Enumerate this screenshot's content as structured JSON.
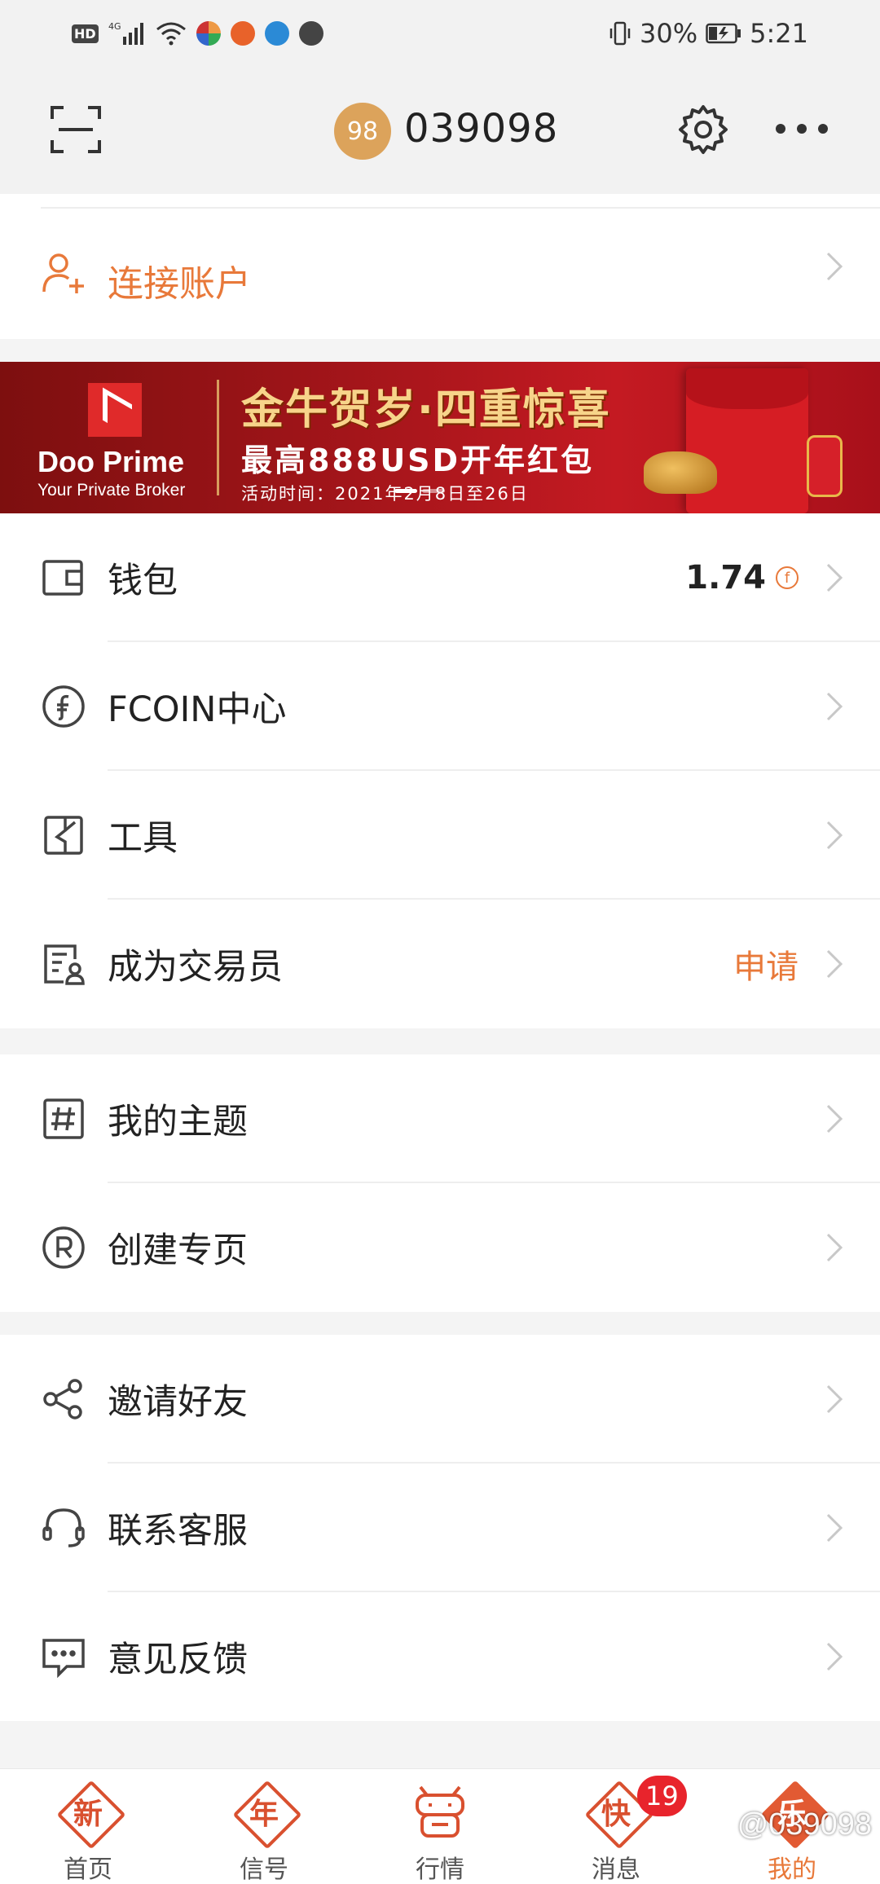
{
  "status_bar": {
    "hd": "HD",
    "signal": "4G",
    "battery": "30%",
    "time": "5:21"
  },
  "header": {
    "avatar_text": "98",
    "username": "039098",
    "icons": [
      "scan-icon",
      "gear-icon",
      "more-icon"
    ]
  },
  "connect": {
    "label": "连接账户",
    "icon": "add-user-icon"
  },
  "banner": {
    "brand": "Doo Prime",
    "brand_sub": "Your Private Broker",
    "headline": "金牛贺岁·四重惊喜",
    "sub": "最高888USD开年红包",
    "date": "活动时间：2021年2月8日至26日"
  },
  "menu_group_1": [
    {
      "label": "钱包",
      "value": "1.74",
      "icon": "wallet-icon",
      "coin": "f"
    },
    {
      "label": "FCOIN中心",
      "icon": "fcoin-icon"
    },
    {
      "label": "工具",
      "icon": "tools-icon"
    },
    {
      "label": "成为交易员",
      "accent": "申请",
      "icon": "trader-icon"
    }
  ],
  "menu_group_2": [
    {
      "label": "我的主题",
      "icon": "hashtag-icon"
    },
    {
      "label": "创建专页",
      "icon": "registered-icon"
    }
  ],
  "menu_group_3": [
    {
      "label": "邀请好友",
      "icon": "share-icon"
    },
    {
      "label": "联系客服",
      "icon": "headset-icon"
    },
    {
      "label": "意见反馈",
      "icon": "feedback-icon"
    }
  ],
  "bottom_nav": [
    {
      "label": "首页",
      "glyph": "新"
    },
    {
      "label": "信号",
      "glyph": "年"
    },
    {
      "label": "行情",
      "glyph": ""
    },
    {
      "label": "消息",
      "glyph": "快",
      "badge": "19"
    },
    {
      "label": "我的",
      "glyph": "乐",
      "active": true
    }
  ],
  "watermark": "@039098",
  "colors": {
    "accent": "#e8793a",
    "nav_red": "#d9502f",
    "badge": "#e8242c",
    "avatar": "#dca35b"
  }
}
